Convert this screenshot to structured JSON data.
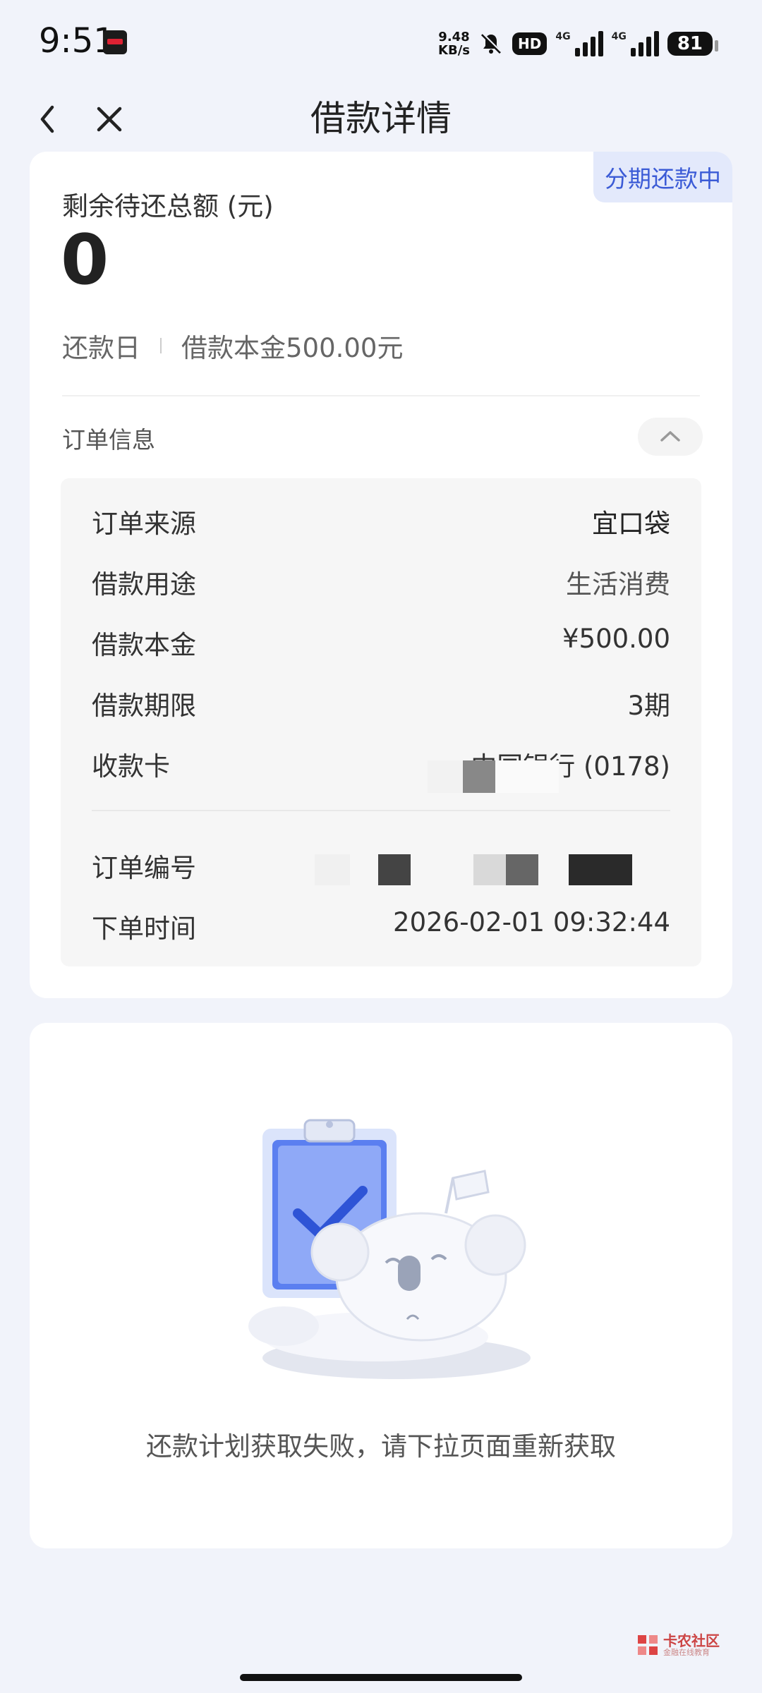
{
  "status_bar": {
    "time": "9:51",
    "speed_value": "9.48",
    "speed_unit": "KB/s",
    "hd": "HD",
    "net1": "4G",
    "net2": "4G",
    "battery": "81"
  },
  "nav": {
    "title": "借款详情"
  },
  "loan": {
    "status_tag": "分期还款中",
    "remaining_label": "剩余待还总额 (元)",
    "remaining_value": "0",
    "repay_day_label": "还款日",
    "principal_summary": "借款本金500.00元"
  },
  "order_info": {
    "section_title": "订单信息",
    "rows": [
      {
        "key": "订单来源",
        "value": "宜口袋"
      },
      {
        "key": "借款用途",
        "value": "生活消费"
      },
      {
        "key": "借款本金",
        "value": "¥500.00"
      },
      {
        "key": "借款期限",
        "value": "3期"
      },
      {
        "key": "收款卡",
        "value": "中国银行 (0178)"
      },
      {
        "key": "订单编号",
        "value": ""
      },
      {
        "key": "下单时间",
        "value": "2026-02-01 09:32:44"
      }
    ]
  },
  "repay_plan": {
    "empty_message": "还款计划获取失败，请下拉页面重新获取"
  },
  "watermark": {
    "text": "卡农社区",
    "sub": "金融在线教育"
  },
  "colors": {
    "page_bg": "#f1f3fa",
    "accent": "#3b5bd6",
    "tag_bg": "#e3e9fb"
  }
}
